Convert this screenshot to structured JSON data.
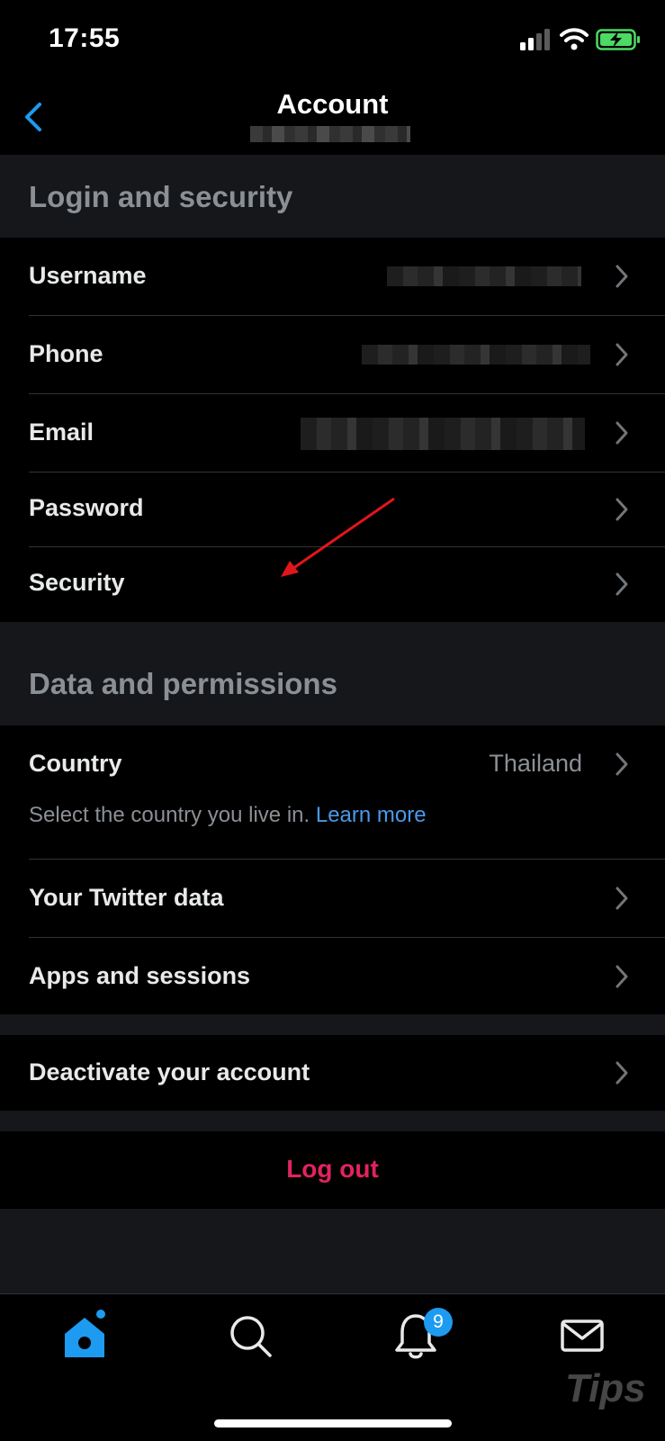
{
  "status_bar": {
    "time": "17:55"
  },
  "header": {
    "title": "Account"
  },
  "sections": {
    "login": {
      "title": "Login and security",
      "rows": [
        {
          "label": "Username"
        },
        {
          "label": "Phone"
        },
        {
          "label": "Email"
        },
        {
          "label": "Password"
        },
        {
          "label": "Security"
        }
      ]
    },
    "data": {
      "title": "Data and permissions",
      "country": {
        "label": "Country",
        "value": "Thailand",
        "helper": "Select the country you live in.",
        "helper_link": "Learn more"
      },
      "rows": [
        {
          "label": "Your Twitter data"
        },
        {
          "label": "Apps and sessions"
        }
      ]
    }
  },
  "deactivate": {
    "label": "Deactivate your account"
  },
  "logout": {
    "label": "Log out"
  },
  "tabbar": {
    "notifications_badge": "9"
  },
  "watermark": {
    "text": "Tips"
  },
  "colors": {
    "accent": "#1d9bf0",
    "link": "#4a99e9",
    "danger": "#e0245e",
    "arrow": "#e0161b"
  }
}
